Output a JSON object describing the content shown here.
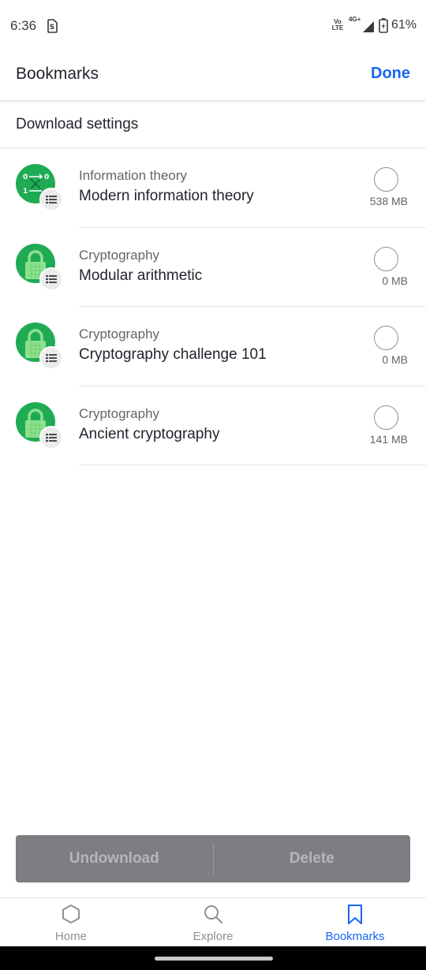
{
  "status_bar": {
    "time": "6:36",
    "volte_top": "Vo",
    "volte_bottom": "LTE",
    "network": "4G+",
    "battery": "61%"
  },
  "header": {
    "title": "Bookmarks",
    "done_label": "Done"
  },
  "settings": {
    "label": "Download settings"
  },
  "items": [
    {
      "subject": "Information theory",
      "title": "Modern information theory",
      "size": "538 MB",
      "icon": "information-theory-icon"
    },
    {
      "subject": "Cryptography",
      "title": "Modular arithmetic",
      "size": "0 MB",
      "icon": "padlock-icon"
    },
    {
      "subject": "Cryptography",
      "title": "Cryptography challenge 101",
      "size": "0 MB",
      "icon": "padlock-icon"
    },
    {
      "subject": "Cryptography",
      "title": "Ancient cryptography",
      "size": "141 MB",
      "icon": "padlock-icon"
    }
  ],
  "actions": {
    "undownload_label": "Undownload",
    "delete_label": "Delete"
  },
  "tabs": [
    {
      "label": "Home",
      "icon": "hexagon-icon",
      "active": false
    },
    {
      "label": "Explore",
      "icon": "search-icon",
      "active": false
    },
    {
      "label": "Bookmarks",
      "icon": "bookmark-icon",
      "active": true
    }
  ],
  "colors": {
    "accent": "#1865f2",
    "course_green": "#1fab54",
    "disabled_bar": "#7c7e82"
  }
}
